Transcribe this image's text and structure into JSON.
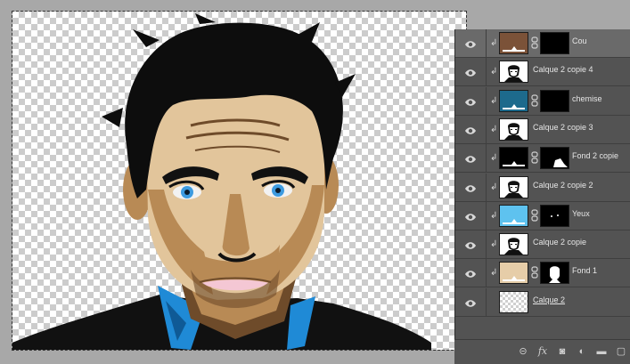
{
  "colors": {
    "skin": "#e2c59b",
    "skin_mid": "#b88a55",
    "skin_dark": "#6e4b2a",
    "hair": "#0d0d0d",
    "eyes": "#3d9be0",
    "shirt": "#1f8ad6",
    "lips": "#f4c7d4",
    "panel_bg": "#535353",
    "selected_row": "#6a6a6a"
  },
  "layers": [
    {
      "name": "Cou",
      "thumb": "color",
      "thumb_color": "#7b5238",
      "mask": "black",
      "selected": true
    },
    {
      "name": "Calque 2 copie 4",
      "thumb": "portrait",
      "mask": "none",
      "selected": false
    },
    {
      "name": "chemise",
      "thumb": "color",
      "thumb_color": "#1d6a8c",
      "mask": "black",
      "selected": false
    },
    {
      "name": "Calque 2 copie 3",
      "thumb": "portrait",
      "mask": "none",
      "selected": false
    },
    {
      "name": "Fond 2 copie",
      "thumb": "color",
      "thumb_color": "#000000",
      "mask": "shape",
      "selected": false
    },
    {
      "name": "Calque 2 copie 2",
      "thumb": "portrait",
      "mask": "none",
      "selected": false
    },
    {
      "name": "Yeux",
      "thumb": "color",
      "thumb_color": "#5ec2ef",
      "mask": "dots",
      "selected": false
    },
    {
      "name": "Calque 2 copie",
      "thumb": "portrait",
      "mask": "none",
      "selected": false
    },
    {
      "name": "Fond 1",
      "thumb": "color",
      "thumb_color": "#e6cda8",
      "mask": "head",
      "selected": false
    },
    {
      "name": "Calque 2",
      "thumb": "transparent",
      "mask": "none",
      "selected": false,
      "underline": true
    }
  ],
  "footer_icons": [
    "link-icon",
    "fx-icon",
    "add-mask-icon",
    "adjustment-icon",
    "folder-icon",
    "new-layer-icon"
  ]
}
